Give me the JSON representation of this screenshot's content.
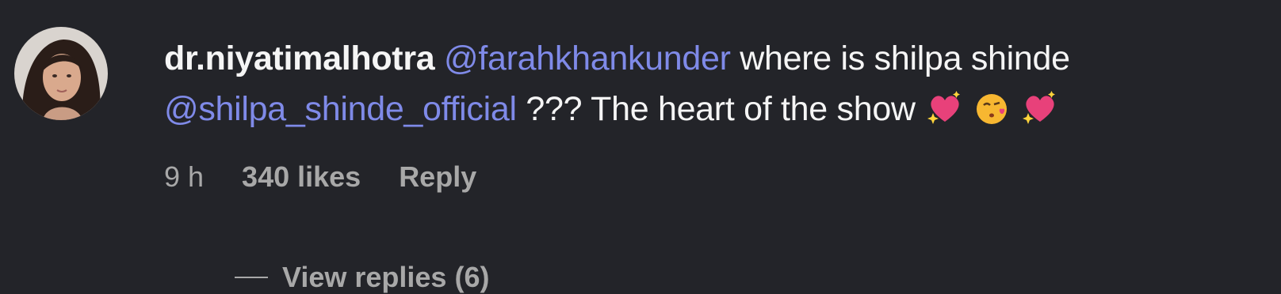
{
  "comment": {
    "username": "dr.niyatimalhotra",
    "mention_1": "@farahkhankunder",
    "text_1": " where is shilpa shinde",
    "mention_2": "@shilpa_shinde_official",
    "text_2": " ??? The heart of the show",
    "emojis": [
      "sparkling-heart",
      "face-blowing-kiss",
      "sparkling-heart"
    ],
    "time": "9 h",
    "likes": "340 likes",
    "reply_label": "Reply",
    "view_replies": "View replies (6)"
  },
  "colors": {
    "background": "#232429",
    "text": "#f5f5f5",
    "mention": "#7f8ae8",
    "muted": "#a8a8a8"
  }
}
